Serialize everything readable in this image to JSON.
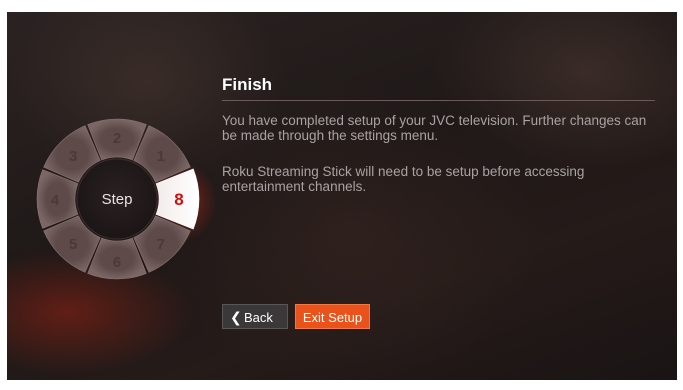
{
  "wheel": {
    "center_label": "Step",
    "current_step": 8,
    "segments": [
      {
        "label": "1"
      },
      {
        "label": "2"
      },
      {
        "label": "3"
      },
      {
        "label": "4"
      },
      {
        "label": "5"
      },
      {
        "label": "6"
      },
      {
        "label": "7"
      },
      {
        "label": "8"
      }
    ]
  },
  "content": {
    "title": "Finish",
    "paragraph_1": "You have completed setup of your JVC television. Further changes can be made through the settings menu.",
    "paragraph_2": "Roku Streaming Stick will need to be setup before accessing entertainment channels."
  },
  "buttons": {
    "back_label": "Back",
    "back_icon": "chevron-left-icon",
    "exit_label": "Exit Setup"
  },
  "colors": {
    "accent": "#e9531b",
    "current_step_text": "#cc1111",
    "segment_text": "#4a3a38"
  }
}
